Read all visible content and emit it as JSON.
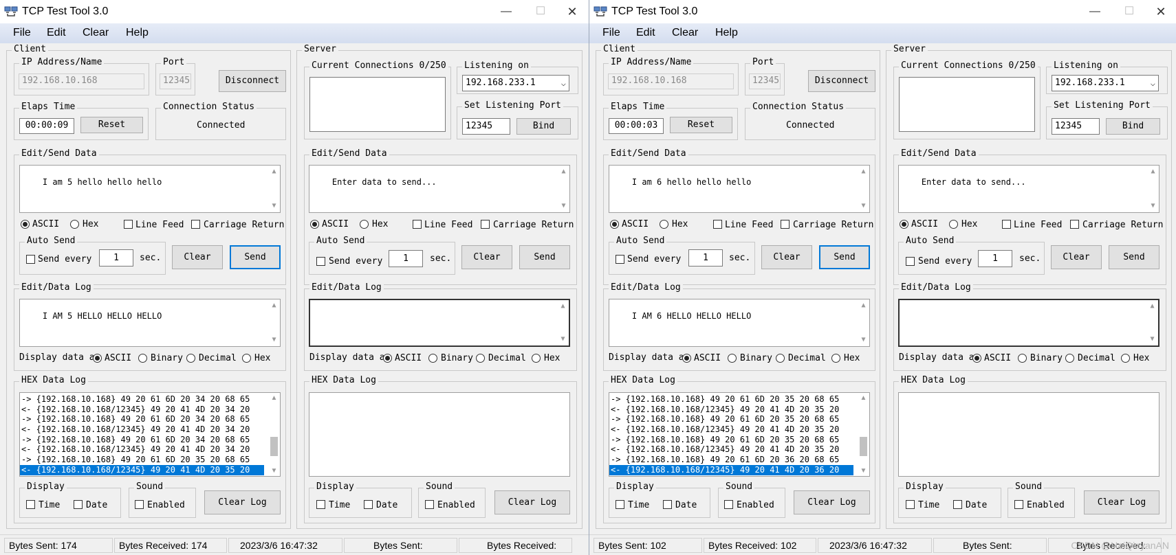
{
  "colors": {
    "selection": "#0078d7",
    "menubar": "#dbe3f3",
    "window": "#f0f0f0"
  },
  "icons": {
    "app": "network-computers-icon",
    "minimize": "minimize-icon",
    "maximize": "maximize-icon",
    "close": "close-icon"
  },
  "windows": [
    {
      "title": "TCP Test Tool 3.0",
      "menu": [
        "File",
        "Edit",
        "Clear",
        "Help"
      ],
      "client": {
        "label": "Client",
        "ip_label": "IP Address/Name",
        "ip_value": "192.168.10.168",
        "port_label": "Port",
        "port_value": "12345",
        "disconnect": "Disconnect",
        "elaps_label": "Elaps Time",
        "elaps_value": "00:00:09",
        "reset": "Reset",
        "status_label": "Connection Status",
        "status_value": "Connected",
        "send_label": "Edit/Send Data",
        "send_text": "I am 5 hello hello hello",
        "ascii": "ASCII",
        "hex": "Hex",
        "line_feed": "Line Feed",
        "carriage_return": "Carriage Return",
        "auto_send": "Auto Send",
        "send_every": "Send every",
        "interval": "1",
        "sec": "sec.",
        "clear": "Clear",
        "send": "Send",
        "log_label": "Edit/Data Log",
        "log_text": "I AM 5 HELLO HELLO HELLO",
        "display_data": "Display data a",
        "opt_ascii": "ASCII",
        "opt_binary": "Binary",
        "opt_decimal": "Decimal",
        "opt_hex": "Hex",
        "hex_label": "HEX Data Log",
        "hex_lines": [
          "-> {192.168.10.168} 49 20 61 6D 20 34 20 68 65",
          "<- {192.168.10.168/12345} 49 20 41 4D 20 34 20",
          "-> {192.168.10.168} 49 20 61 6D 20 34 20 68 65",
          "<- {192.168.10.168/12345} 49 20 41 4D 20 34 20",
          "-> {192.168.10.168} 49 20 61 6D 20 34 20 68 65",
          "<- {192.168.10.168/12345} 49 20 41 4D 20 34 20",
          "-> {192.168.10.168} 49 20 61 6D 20 35 20 68 65",
          "<- {192.168.10.168/12345} 49 20 41 4D 20 35 20"
        ],
        "display_label": "Display",
        "time": "Time",
        "date": "Date",
        "sound_label": "Sound",
        "enabled": "Enabled",
        "clear_log": "Clear Log"
      },
      "server": {
        "label": "Server",
        "connections_label": "Current Connections 0/250",
        "listening_label": "Listening on",
        "listening_value": "192.168.233.1",
        "port_label": "Set Listening Port",
        "port_value": "12345",
        "bind": "Bind",
        "send_label": "Edit/Send Data",
        "send_placeholder": "Enter data to send...",
        "ascii": "ASCII",
        "hex": "Hex",
        "line_feed": "Line Feed",
        "carriage_return": "Carriage Return",
        "auto_send": "Auto Send",
        "send_every": "Send every",
        "interval": "1",
        "sec": "sec.",
        "clear": "Clear",
        "send": "Send",
        "log_label": "Edit/Data Log",
        "display_data": "Display data a",
        "opt_ascii": "ASCII",
        "opt_binary": "Binary",
        "opt_decimal": "Decimal",
        "opt_hex": "Hex",
        "hex_label": "HEX Data Log",
        "display_label": "Display",
        "time": "Time",
        "date": "Date",
        "sound_label": "Sound",
        "enabled": "Enabled",
        "clear_log": "Clear Log"
      },
      "status": [
        "Bytes Sent: 174",
        "Bytes Received: 174",
        "2023/3/6 16:47:32",
        "Bytes Sent:",
        "Bytes Received:"
      ]
    },
    {
      "title": "TCP Test Tool 3.0",
      "menu": [
        "File",
        "Edit",
        "Clear",
        "Help"
      ],
      "client": {
        "label": "Client",
        "ip_label": "IP Address/Name",
        "ip_value": "192.168.10.168",
        "port_label": "Port",
        "port_value": "12345",
        "disconnect": "Disconnect",
        "elaps_label": "Elaps Time",
        "elaps_value": "00:00:03",
        "reset": "Reset",
        "status_label": "Connection Status",
        "status_value": "Connected",
        "send_label": "Edit/Send Data",
        "send_text": "I am 6 hello hello hello",
        "ascii": "ASCII",
        "hex": "Hex",
        "line_feed": "Line Feed",
        "carriage_return": "Carriage Return",
        "auto_send": "Auto Send",
        "send_every": "Send every",
        "interval": "1",
        "sec": "sec.",
        "clear": "Clear",
        "send": "Send",
        "log_label": "Edit/Data Log",
        "log_text": "I AM 6 HELLO HELLO HELLO",
        "display_data": "Display data a",
        "opt_ascii": "ASCII",
        "opt_binary": "Binary",
        "opt_decimal": "Decimal",
        "opt_hex": "Hex",
        "hex_label": "HEX Data Log",
        "hex_lines": [
          "-> {192.168.10.168} 49 20 61 6D 20 35 20 68 65",
          "<- {192.168.10.168/12345} 49 20 41 4D 20 35 20",
          "-> {192.168.10.168} 49 20 61 6D 20 35 20 68 65",
          "<- {192.168.10.168/12345} 49 20 41 4D 20 35 20",
          "-> {192.168.10.168} 49 20 61 6D 20 35 20 68 65",
          "<- {192.168.10.168/12345} 49 20 41 4D 20 35 20",
          "-> {192.168.10.168} 49 20 61 6D 20 36 20 68 65",
          "<- {192.168.10.168/12345} 49 20 41 4D 20 36 20"
        ],
        "display_label": "Display",
        "time": "Time",
        "date": "Date",
        "sound_label": "Sound",
        "enabled": "Enabled",
        "clear_log": "Clear Log"
      },
      "server": {
        "label": "Server",
        "connections_label": "Current Connections 0/250",
        "listening_label": "Listening on",
        "listening_value": "192.168.233.1",
        "port_label": "Set Listening Port",
        "port_value": "12345",
        "bind": "Bind",
        "send_label": "Edit/Send Data",
        "send_placeholder": "Enter data to send...",
        "ascii": "ASCII",
        "hex": "Hex",
        "line_feed": "Line Feed",
        "carriage_return": "Carriage Return",
        "auto_send": "Auto Send",
        "send_every": "Send every",
        "interval": "1",
        "sec": "sec.",
        "clear": "Clear",
        "send": "Send",
        "log_label": "Edit/Data Log",
        "display_data": "Display data a",
        "opt_ascii": "ASCII",
        "opt_binary": "Binary",
        "opt_decimal": "Decimal",
        "opt_hex": "Hex",
        "hex_label": "HEX Data Log",
        "display_label": "Display",
        "time": "Time",
        "date": "Date",
        "sound_label": "Sound",
        "enabled": "Enabled",
        "clear_log": "Clear Log"
      },
      "status": [
        "Bytes Sent: 102",
        "Bytes Received: 102",
        "2023/3/6 16:47:32",
        "Bytes Sent:",
        "Bytes Received:"
      ]
    }
  ],
  "watermark": "CSDN @HaiQinyanAN"
}
